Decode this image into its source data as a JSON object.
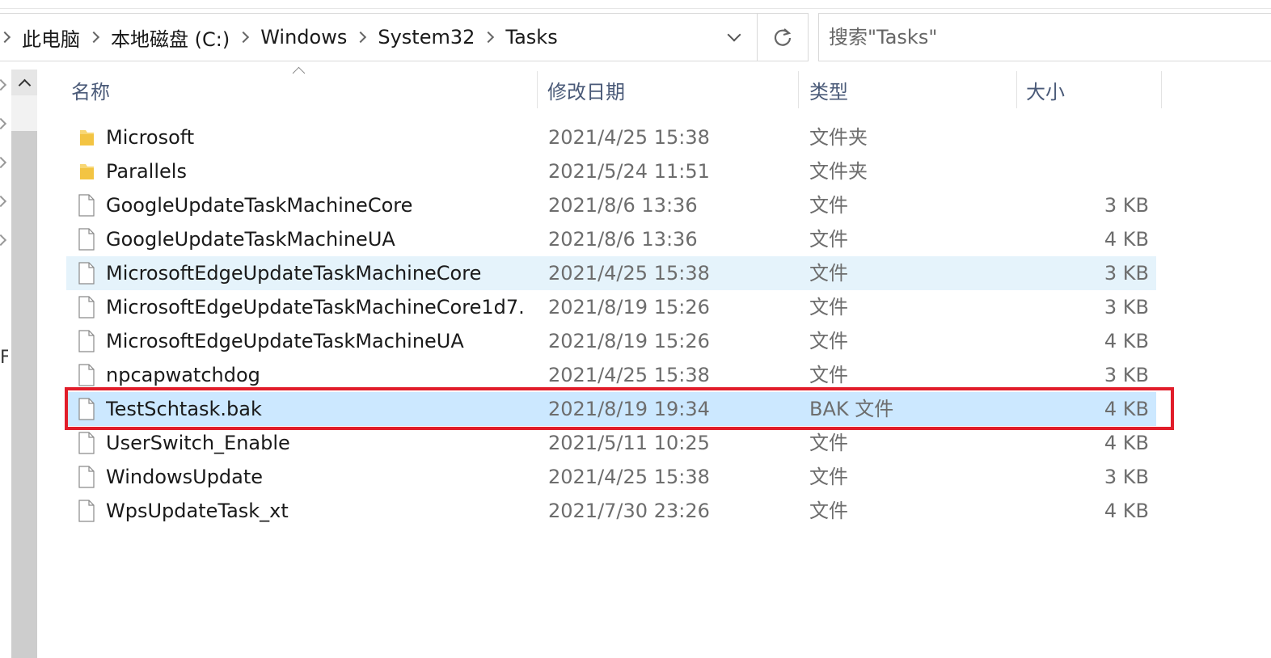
{
  "address_bar": {
    "crumbs": [
      "此电脑",
      "本地磁盘 (C:)",
      "Windows",
      "System32",
      "Tasks"
    ]
  },
  "search": {
    "placeholder": "搜索\"Tasks\""
  },
  "nav_pane": {
    "partial_text": "F"
  },
  "columns": {
    "name": "名称",
    "date": "修改日期",
    "type": "类型",
    "size": "大小"
  },
  "files": [
    {
      "name": "Microsoft",
      "date": "2021/4/25 15:38",
      "type": "文件夹",
      "size": "",
      "icon": "folder-icon"
    },
    {
      "name": "Parallels",
      "date": "2021/5/24 11:51",
      "type": "文件夹",
      "size": "",
      "icon": "folder-icon"
    },
    {
      "name": "GoogleUpdateTaskMachineCore",
      "date": "2021/8/6 13:36",
      "type": "文件",
      "size": "3 KB",
      "icon": "file-icon"
    },
    {
      "name": "GoogleUpdateTaskMachineUA",
      "date": "2021/8/6 13:36",
      "type": "文件",
      "size": "4 KB",
      "icon": "file-icon"
    },
    {
      "name": "MicrosoftEdgeUpdateTaskMachineCore",
      "date": "2021/4/25 15:38",
      "type": "文件",
      "size": "3 KB",
      "icon": "file-icon"
    },
    {
      "name": "MicrosoftEdgeUpdateTaskMachineCore1d7...",
      "date": "2021/8/19 15:26",
      "type": "文件",
      "size": "3 KB",
      "icon": "file-icon"
    },
    {
      "name": "MicrosoftEdgeUpdateTaskMachineUA",
      "date": "2021/8/19 15:26",
      "type": "文件",
      "size": "4 KB",
      "icon": "file-icon"
    },
    {
      "name": "npcapwatchdog",
      "date": "2021/4/25 15:38",
      "type": "文件",
      "size": "3 KB",
      "icon": "file-icon"
    },
    {
      "name": "TestSchtask.bak",
      "date": "2021/8/19 19:34",
      "type": "BAK 文件",
      "size": "4 KB",
      "icon": "file-icon"
    },
    {
      "name": "UserSwitch_Enable",
      "date": "2021/5/11 10:25",
      "type": "文件",
      "size": "4 KB",
      "icon": "file-icon"
    },
    {
      "name": "WindowsUpdate",
      "date": "2021/4/25 15:38",
      "type": "文件",
      "size": "3 KB",
      "icon": "file-icon"
    },
    {
      "name": "WpsUpdateTask_xt",
      "date": "2021/7/30 23:26",
      "type": "文件",
      "size": "4 KB",
      "icon": "file-icon"
    }
  ],
  "colors": {
    "selected_row": "#cce8ff",
    "hover_row": "#e5f3fb",
    "annotation_box": "#e11d2a",
    "header_text": "#4a5a78",
    "folder_yellow": "#f8d775"
  }
}
